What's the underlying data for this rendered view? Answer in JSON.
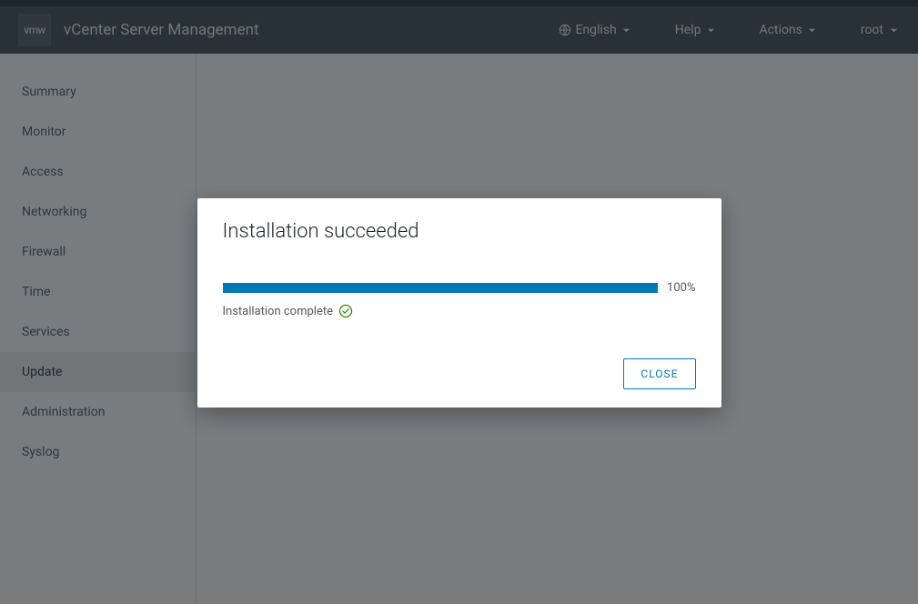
{
  "header": {
    "logo_text": "vmw",
    "title": "vCenter Server Management",
    "language": "English",
    "help": "Help",
    "actions": "Actions",
    "user": "root"
  },
  "sidebar": {
    "items": [
      {
        "label": "Summary",
        "selected": false
      },
      {
        "label": "Monitor",
        "selected": false
      },
      {
        "label": "Access",
        "selected": false
      },
      {
        "label": "Networking",
        "selected": false
      },
      {
        "label": "Firewall",
        "selected": false
      },
      {
        "label": "Time",
        "selected": false
      },
      {
        "label": "Services",
        "selected": false
      },
      {
        "label": "Update",
        "selected": true
      },
      {
        "label": "Administration",
        "selected": false
      },
      {
        "label": "Syslog",
        "selected": false
      }
    ]
  },
  "modal": {
    "title": "Installation succeeded",
    "progress_pct": 100,
    "progress_label": "100%",
    "status_text": "Installation complete",
    "close_label": "CLOSE"
  }
}
